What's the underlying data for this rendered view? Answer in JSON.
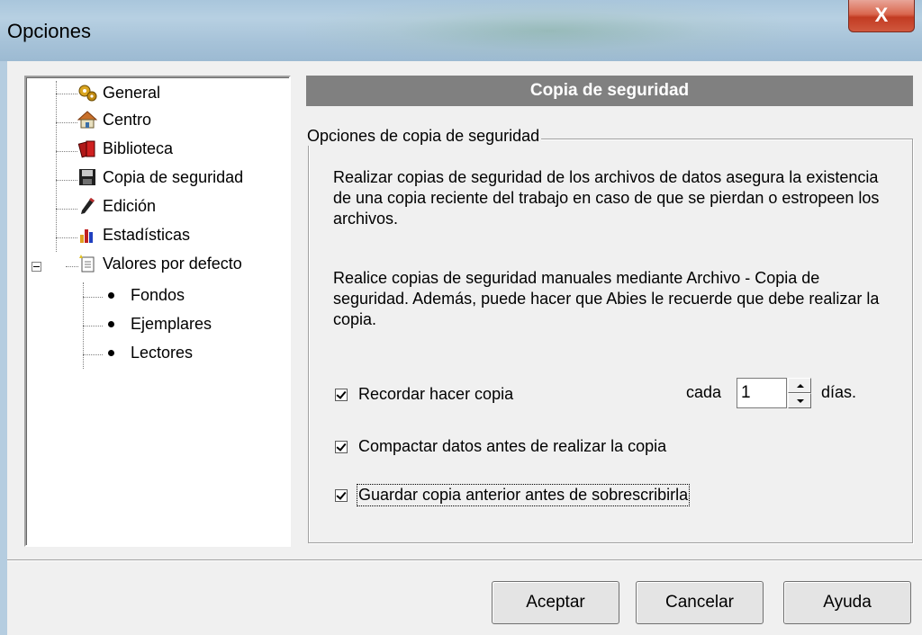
{
  "window": {
    "title": "Opciones",
    "close_label": "X"
  },
  "tree": {
    "items": [
      {
        "label": "General",
        "icon": "gears-icon"
      },
      {
        "label": "Centro",
        "icon": "house-icon"
      },
      {
        "label": "Biblioteca",
        "icon": "books-icon"
      },
      {
        "label": "Copia de seguridad",
        "icon": "floppy-disk-icon"
      },
      {
        "label": "Edición",
        "icon": "pencil-icon"
      },
      {
        "label": "Estadísticas",
        "icon": "bar-chart-icon"
      },
      {
        "label": "Valores por defecto",
        "icon": "document-icon"
      }
    ],
    "children": [
      {
        "label": "Fondos"
      },
      {
        "label": "Ejemplares"
      },
      {
        "label": "Lectores"
      }
    ]
  },
  "panel": {
    "header": "Copia de seguridad",
    "group_title": "Opciones de copia de seguridad",
    "paragraph1": "Realizar copias de seguridad de los archivos de datos asegura la existencia de una copia reciente del trabajo en caso de que se pierdan o estropeen los archivos.",
    "paragraph2": "Realice copias de seguridad manuales mediante Archivo - Copia de seguridad. Además, puede hacer que Abies le recuerde que debe realizar la copia.",
    "remind": {
      "label": "Recordar hacer copia",
      "checked": true
    },
    "every_label": "cada",
    "every_value": "1",
    "days_label": "días.",
    "compact": {
      "label": "Compactar datos antes de realizar la copia",
      "checked": true
    },
    "keep_previous": {
      "label": "Guardar copia anterior antes de sobrescribirla",
      "checked": true
    }
  },
  "buttons": {
    "accept": "Aceptar",
    "cancel": "Cancelar",
    "help": "Ayuda"
  }
}
